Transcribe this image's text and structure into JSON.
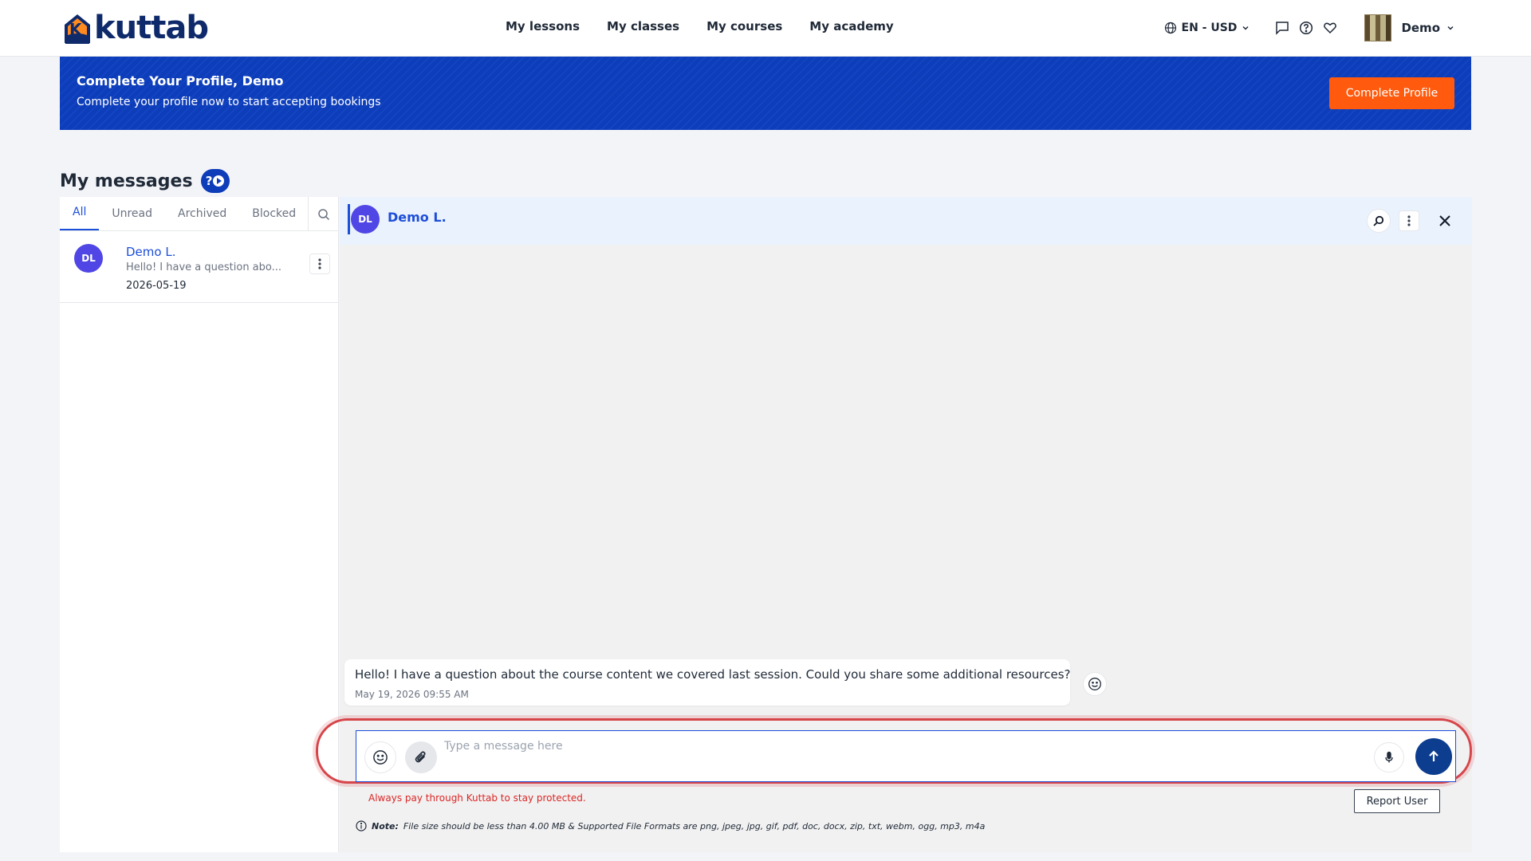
{
  "brand": {
    "name": "kuttab",
    "mark": "K"
  },
  "nav": {
    "links": [
      "My lessons",
      "My classes",
      "My courses",
      "My academy"
    ],
    "locale": "EN - USD",
    "user": "Demo"
  },
  "banner": {
    "title": "Complete Your Profile, Demo",
    "subtitle": "Complete your profile now to start accepting bookings",
    "button": "Complete Profile"
  },
  "page": {
    "title": "My messages",
    "help": "?"
  },
  "tabs": [
    "All",
    "Unread",
    "Archived",
    "Blocked"
  ],
  "conversations": [
    {
      "initials": "DL",
      "name": "Demo L.",
      "preview": "Hello! I have a question abo...",
      "date": "2026-05-19"
    }
  ],
  "chat": {
    "initials": "DL",
    "name": "Demo L.",
    "messages": [
      {
        "text": "Hello! I have a question about the course content we covered last session. Could you share some additional resources?",
        "time": "May 19, 2026 09:55 AM"
      }
    ],
    "composer_placeholder": "Type a message here",
    "warning": "Always pay through Kuttab to stay protected.",
    "report": "Report User",
    "note_label": "Note:",
    "note_text": "File size should be less than 4.00 MB & Supported File Formats are png, jpeg, jpg, gif, pdf, doc, docx, zip, txt, webm, ogg, mp3, m4a"
  },
  "colors": {
    "brand_blue": "#0d3db8",
    "accent_orange": "#ff5a0d",
    "link_blue": "#1d4ed8",
    "send_blue": "#0d3d8f",
    "avatar_purple": "#4f46e5",
    "warning_red": "#dc2626"
  }
}
